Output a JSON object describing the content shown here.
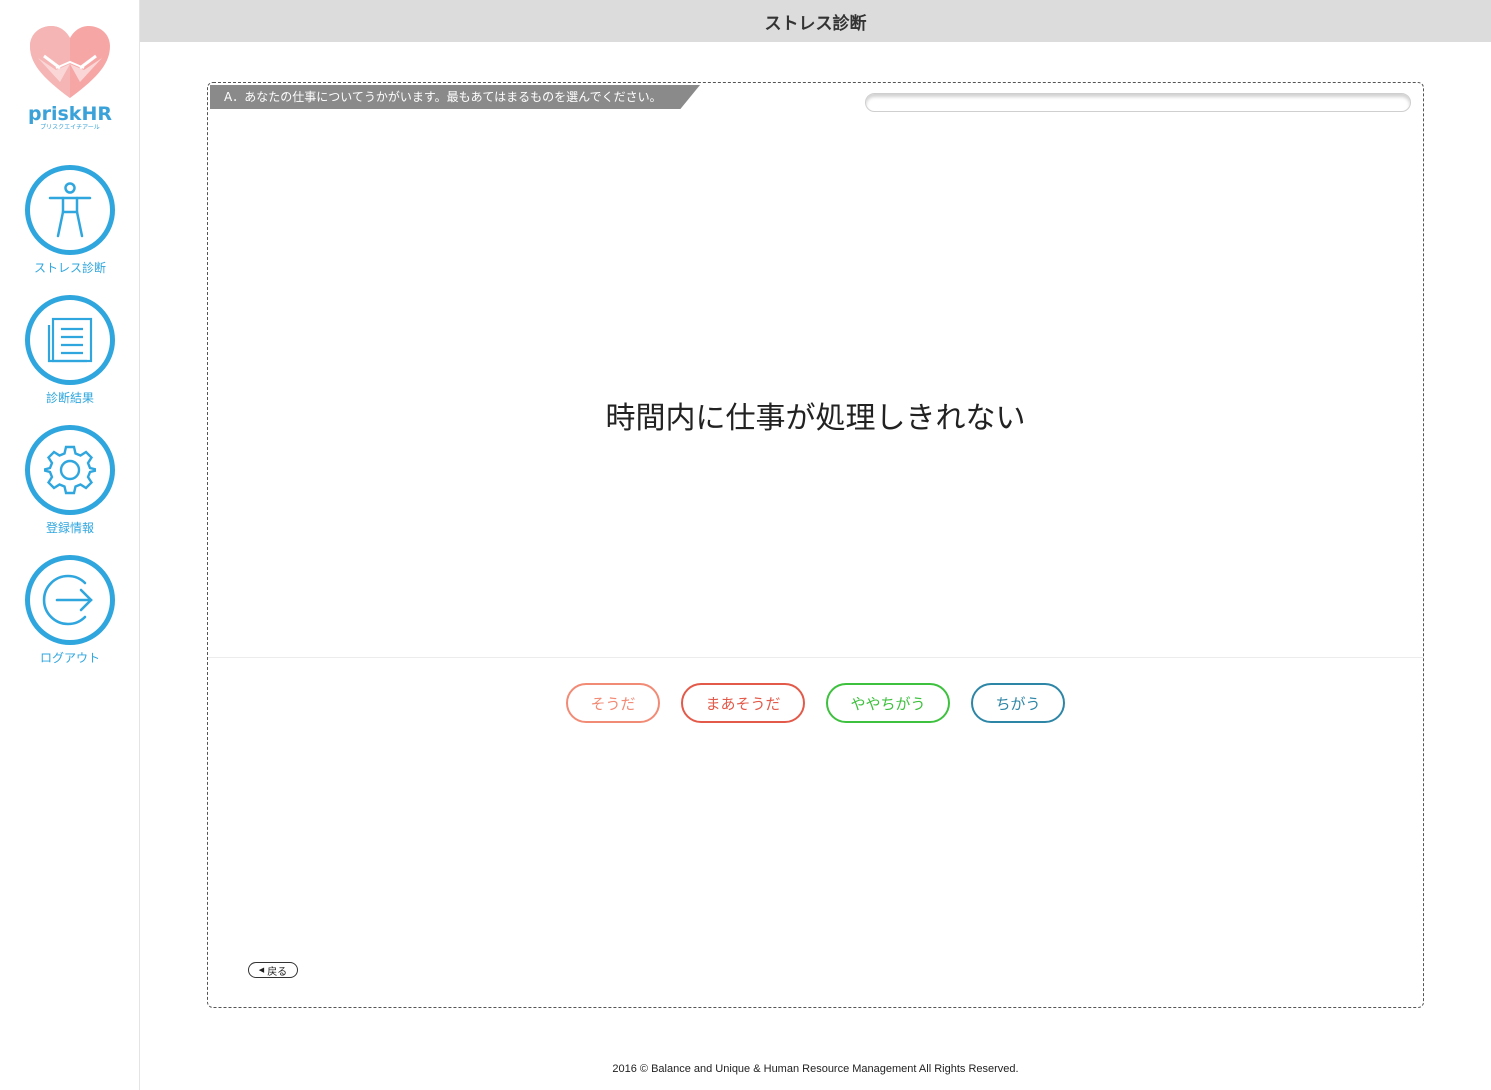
{
  "app": {
    "logo_text": "priskHR",
    "logo_subtext": "プリスクエイチアール"
  },
  "header": {
    "title": "ストレス診断"
  },
  "sidebar": {
    "items": [
      {
        "label": "ストレス診断",
        "icon": "person-icon"
      },
      {
        "label": "診断結果",
        "icon": "document-icon"
      },
      {
        "label": "登録情報",
        "icon": "gear-icon"
      },
      {
        "label": "ログアウト",
        "icon": "logout-icon"
      }
    ]
  },
  "question_card": {
    "section_instruction": "A．あなたの仕事についてうかがいます。最もあてはまるものを選んでください。",
    "progress_percent": 0,
    "question_text": "時間内に仕事が処理しきれない",
    "answers": [
      {
        "label": "そうだ",
        "color": "#f28b76"
      },
      {
        "label": "まあそうだ",
        "color": "#e35a4a"
      },
      {
        "label": "ややちがう",
        "color": "#3ec13e"
      },
      {
        "label": "ちがう",
        "color": "#2e86a7"
      }
    ],
    "back_label": "戻る"
  },
  "footer": {
    "copyright": "2016 © Balance and Unique & Human Resource Management All Rights Reserved."
  },
  "colors": {
    "accent": "#2fa6de",
    "header_bg": "#dcdcdc",
    "banner_bg": "#8a8a8a"
  }
}
